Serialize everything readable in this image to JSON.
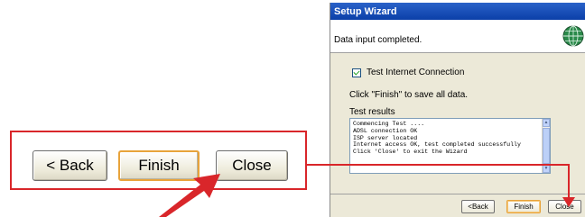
{
  "callout": {
    "back_label": "< Back",
    "finish_label": "Finish",
    "close_label": "Close"
  },
  "wizard": {
    "title": "Setup Wizard",
    "header_text": "Data input completed.",
    "header_icon": "globe-icon",
    "checkbox_label": "Test Internet Connection",
    "checkbox_checked": true,
    "finish_hint": "Click \"Finish\" to save all data.",
    "results_label": "Test results",
    "results_text": "Commencing Test ....\nADSL connection OK\nISP server located\nInternet access OK, test completed successfully\nClick 'Close' to exit the Wizard",
    "buttons": {
      "back_label": "<Back",
      "finish_label": "Finish",
      "close_label": "Close"
    }
  },
  "colors": {
    "callout_border": "#d9262a",
    "arrow": "#d9262a",
    "titlebar": "#0b3fa8",
    "default_button_border": "#e8a33b"
  }
}
